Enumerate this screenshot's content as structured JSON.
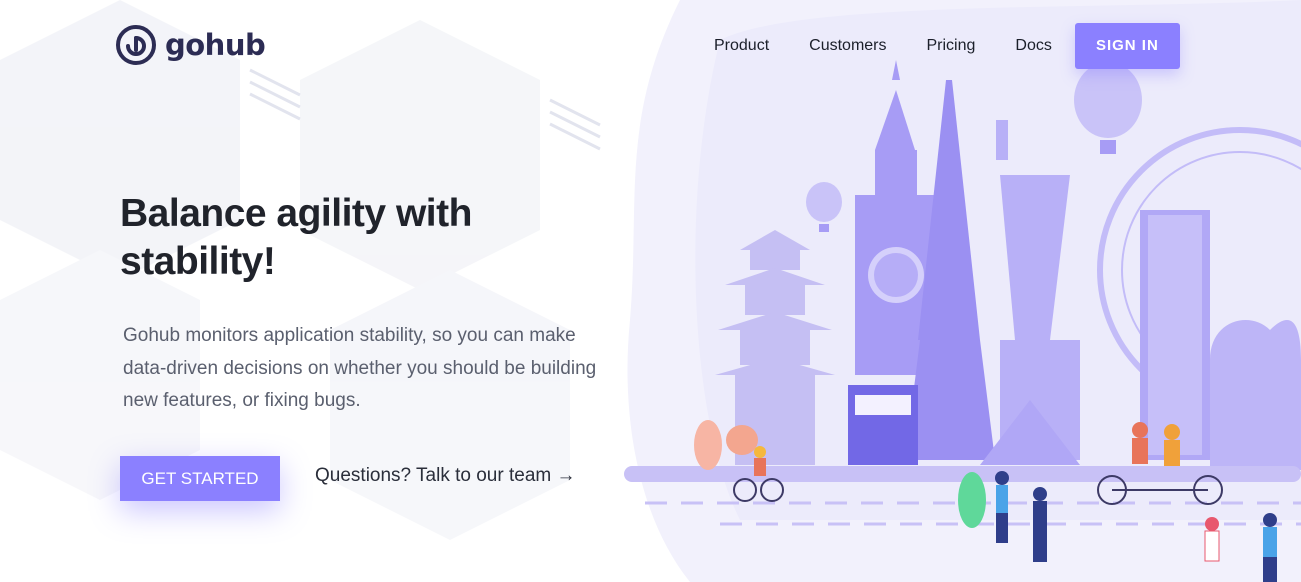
{
  "brand": {
    "name": "gohub",
    "logo_icon": "gohub-logo-icon"
  },
  "nav": {
    "links": [
      "Product",
      "Customers",
      "Pricing",
      "Docs"
    ],
    "signin_label": "SIGN IN"
  },
  "hero": {
    "headline": "Balance agility with stability!",
    "subtext": "Gohub monitors application stability, so you can make data-driven decisions on whether you should be building new features, or fixing bugs.",
    "cta_label": "GET STARTED",
    "secondary_link": "Questions? Talk to our team →"
  },
  "colors": {
    "accent": "#8b80ff",
    "dark": "#20232b",
    "illustration": "#a79cf5"
  }
}
